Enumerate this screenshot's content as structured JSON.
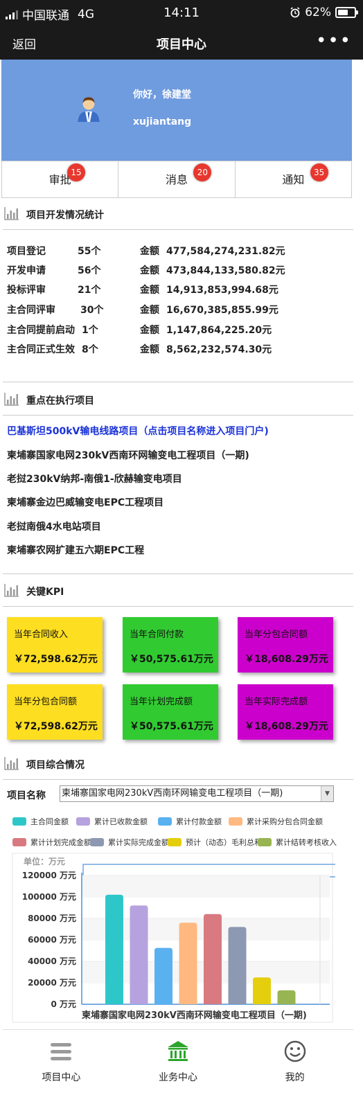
{
  "status_bar": {
    "carrier": "中国联通",
    "network": "4G",
    "time": "14:11",
    "battery": "62%",
    "battery_level": 0.62
  },
  "nav": {
    "back": "返回",
    "title": "项目中心",
    "more": "•••"
  },
  "profile": {
    "greeting": "你好，徐建堂",
    "username": "xujiantang"
  },
  "tabs": [
    {
      "label": "审批",
      "badge": "15"
    },
    {
      "label": "消息",
      "badge": "20"
    },
    {
      "label": "通知",
      "badge": "35"
    }
  ],
  "sections": {
    "dev_stats": "项目开发情况统计",
    "key_projects": "重点在执行项目",
    "kpi": "关键KPI",
    "overview": "项目综合情况"
  },
  "stats": [
    {
      "name": "项目登记",
      "count": "55个",
      "amount_label": "金额",
      "amount": "477,584,274,231.82元"
    },
    {
      "name": "开发申请",
      "count": "56个",
      "amount_label": "金额",
      "amount": "473,844,133,580.82元"
    },
    {
      "name": "投标评审",
      "count": "21个",
      "amount_label": "金额",
      "amount": "14,913,853,994.68元"
    },
    {
      "name": "主合同评审",
      "count": "30个",
      "amount_label": "金额",
      "amount": "16,670,385,855.99元"
    },
    {
      "name": "主合同提前启动",
      "count": "1个",
      "amount_label": "金额",
      "amount": "1,147,864,225.20元"
    },
    {
      "name": "主合同正式生效",
      "count": "8个",
      "amount_label": "金额",
      "amount": "8,562,232,574.30元"
    }
  ],
  "projects": [
    "巴基斯坦500kV输电线路项目（点击项目名称进入项目门户)",
    "柬埔寨国家电网230kV西南环网输变电工程项目（一期)",
    "老挝230kV纳邦-南俄1-欣赫输变电项目",
    "柬埔寨金边巴威输变电EPC工程项目",
    "老挝南俄4水电站项目",
    "柬埔寨农网扩建五六期EPC工程"
  ],
  "kpis": [
    {
      "label": "当年合同收入",
      "value": "￥72,598.62万元",
      "color": "#fede21"
    },
    {
      "label": "当年合同付款",
      "value": "￥50,575.61万元",
      "color": "#31cb31"
    },
    {
      "label": "当年分包合同额",
      "value": "￥18,608.29万元",
      "color": "#cc00cc"
    },
    {
      "label": "当年分包合同额",
      "value": "￥72,598.62万元",
      "color": "#fede21"
    },
    {
      "label": "当年计划完成额",
      "value": "￥50,575.61万元",
      "color": "#31cb31"
    },
    {
      "label": "当年实际完成额",
      "value": "￥18,608.29万元",
      "color": "#cc00cc"
    }
  ],
  "overview": {
    "select_label": "项目名称",
    "select_value": "柬埔寨国家电网230kV西南环网输变电工程项目（一期)"
  },
  "legend": [
    {
      "name": "主合同金额",
      "color": "#2ec7c9"
    },
    {
      "name": "累计已收款金额",
      "color": "#b6a2de"
    },
    {
      "name": "累计付款金额",
      "color": "#5ab1ef"
    },
    {
      "name": "累计采购分包合同金额",
      "color": "#ffb980"
    },
    {
      "name": "累计计划完成金额",
      "color": "#d87a80"
    },
    {
      "name": "累计实际完成金额",
      "color": "#8d98b3"
    },
    {
      "name": "预计（动态）毛利总和",
      "color": "#e5cf0d"
    },
    {
      "name": "累计结转考核收入",
      "color": "#97b552"
    }
  ],
  "chart_data": {
    "type": "bar",
    "unit_label": "单位：万元",
    "categories": [
      "柬埔寨国家电网230kV西南环网输变电工程项目（一期)"
    ],
    "y_ticks": [
      "0 万元",
      "20000 万元",
      "40000 万元",
      "60000 万元",
      "80000 万元",
      "100000 万元",
      "120000 万元"
    ],
    "ylim": [
      0,
      120000
    ],
    "series": [
      {
        "name": "主合同金额",
        "values": [
          102000
        ]
      },
      {
        "name": "累计已收款金额",
        "values": [
          92000
        ]
      },
      {
        "name": "累计付款金额",
        "values": [
          52500
        ]
      },
      {
        "name": "累计采购分包合同金额",
        "values": [
          76000
        ]
      },
      {
        "name": "累计计划完成金额",
        "values": [
          84000
        ]
      },
      {
        "name": "累计实际完成金额",
        "values": [
          72000
        ]
      },
      {
        "name": "预计（动态）毛利总和",
        "values": [
          25000
        ]
      },
      {
        "name": "累计结转考核收入",
        "values": [
          13000
        ]
      }
    ]
  },
  "bottom_nav": [
    {
      "label": "项目中心",
      "icon": "menu-icon"
    },
    {
      "label": "业务中心",
      "icon": "bank-icon"
    },
    {
      "label": "我的",
      "icon": "smiley-icon"
    }
  ]
}
